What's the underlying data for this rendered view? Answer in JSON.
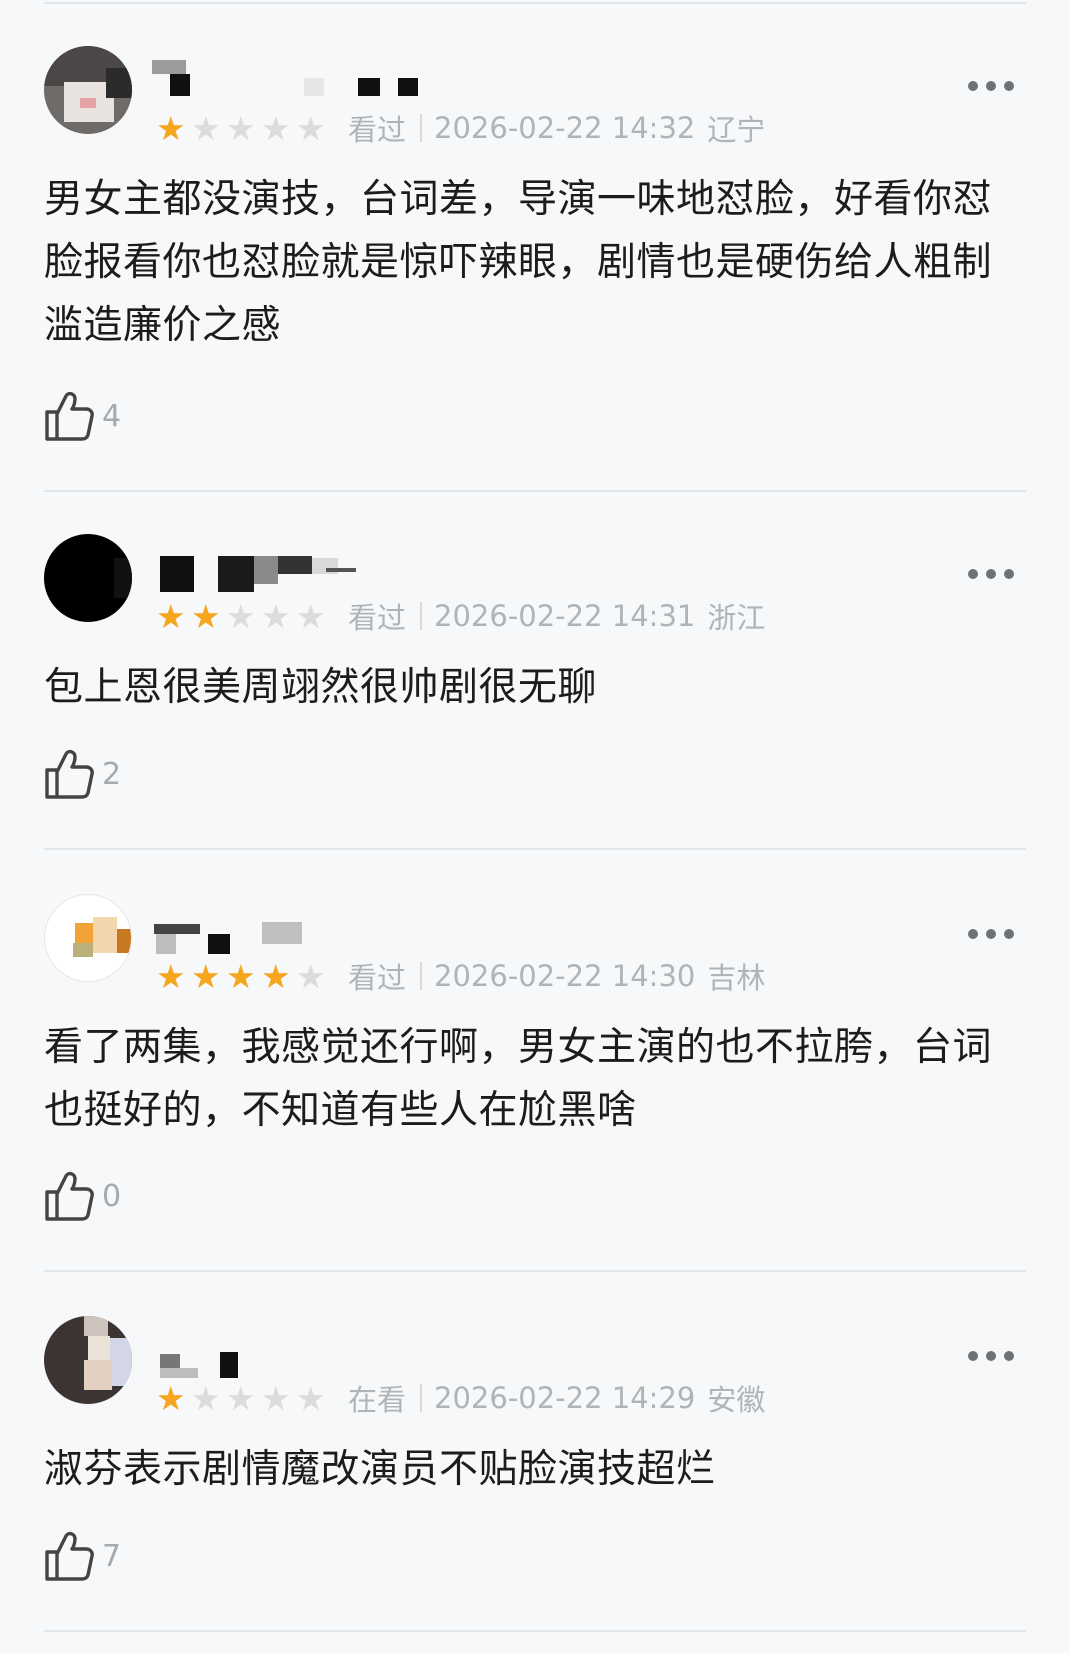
{
  "colors": {
    "background": "#f6f8f9",
    "star_on": "#f6a51e",
    "star_off": "#dcdcdc",
    "meta_text": "#b1b4b7",
    "body_text": "#1c1c1c"
  },
  "reviews": [
    {
      "rating": 1,
      "status": "看过",
      "datetime": "2026-02-22 14:32",
      "region": "辽宁",
      "text": "男女主都没演技，台词差，导演一味地怼脸，好看你怼脸报看你也怼脸就是惊吓辣眼，剧情也是硬伤给人粗制滥造廉价之感",
      "likes": "4"
    },
    {
      "rating": 2,
      "status": "看过",
      "datetime": "2026-02-22 14:31",
      "region": "浙江",
      "text": "包上恩很美周翊然很帅剧很无聊",
      "likes": "2"
    },
    {
      "rating": 4,
      "status": "看过",
      "datetime": "2026-02-22 14:30",
      "region": "吉林",
      "text": "看了两集，我感觉还行啊，男女主演的也不拉胯，台词也挺好的，不知道有些人在尬黑啥",
      "likes": "0"
    },
    {
      "rating": 1,
      "status": "在看",
      "datetime": "2026-02-22 14:29",
      "region": "安徽",
      "text": "淑芬表示剧情魔改演员不贴脸演技超烂",
      "likes": "7"
    }
  ],
  "icons": {
    "more": "more-dots-icon",
    "like": "thumbs-up-icon",
    "star": "star-icon"
  }
}
